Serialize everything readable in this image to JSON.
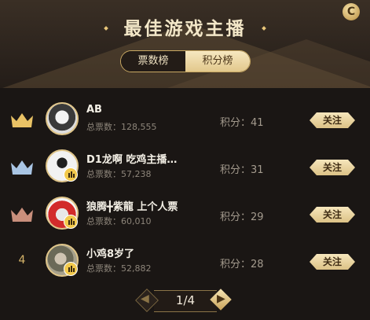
{
  "header": {
    "title": "最佳游戏主播",
    "tabs": [
      {
        "label": "票数榜",
        "active": true
      },
      {
        "label": "积分榜",
        "active": false
      }
    ],
    "refresh_icon": "C"
  },
  "list": [
    {
      "rank": "1",
      "crown": "gold",
      "name": "AB",
      "votes": "总票数：128,555",
      "score": "积分：41",
      "follow": "关注"
    },
    {
      "rank": "2",
      "crown": "silver",
      "name": "D1龙啊 吃鸡主播…",
      "votes": "总票数：57,238",
      "score": "积分：31",
      "follow": "关注"
    },
    {
      "rank": "3",
      "crown": "bronze",
      "name": "狼腾╋紫龍 上个人票",
      "votes": "总票数：60,010",
      "score": "积分：29",
      "follow": "关注"
    },
    {
      "rank": "4",
      "crown": "",
      "name": "小鸡8岁了",
      "votes": "总票数：52,882",
      "score": "积分：28",
      "follow": "关注"
    }
  ],
  "pager": {
    "label": "1/4"
  },
  "colors": {
    "gold": "#e9c265",
    "silver": "#a9c5e4",
    "bronze": "#c98f7c"
  }
}
